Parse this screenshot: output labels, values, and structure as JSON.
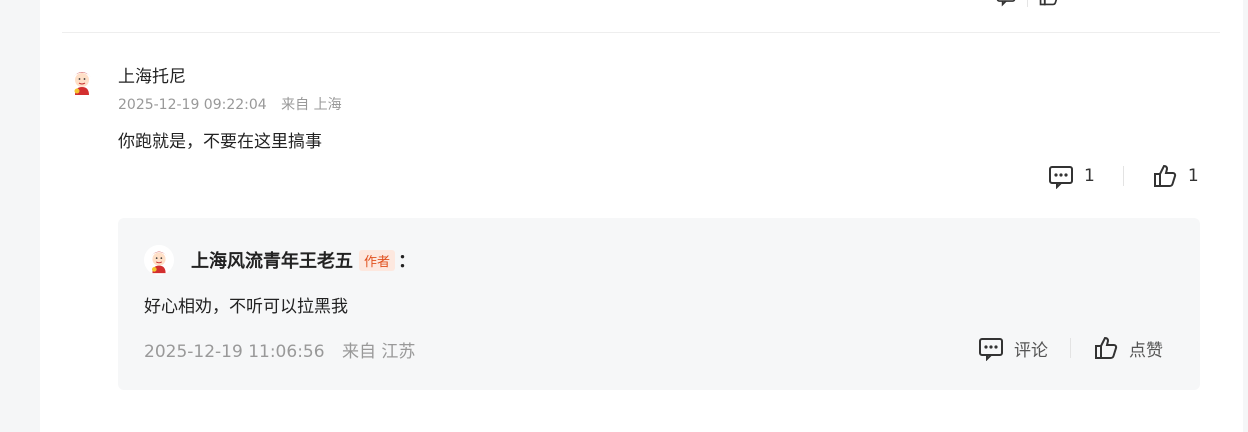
{
  "comment": {
    "username": "上海托尼",
    "timestamp": "2025-12-19 09:22:04",
    "location": "来自 上海",
    "text": "你跑就是，不要在这里搞事",
    "reply_count": "1",
    "like_count": "1"
  },
  "reply": {
    "username": "上海风流青年王老五",
    "author_tag": "作者",
    "colon": "：",
    "text": "好心相劝，不听可以拉黑我",
    "timestamp": "2025-12-19 11:06:56",
    "location": "来自 江苏",
    "comment_label": "评论",
    "like_label": "点赞"
  },
  "icons": [
    "comment-icon",
    "thumbs-up-icon",
    "avatar-icon"
  ],
  "colors": {
    "author_tag_text": "#e0501d",
    "author_tag_bg": "#fde8df",
    "meta_text": "#999999",
    "reply_bg": "#f6f7f8"
  }
}
